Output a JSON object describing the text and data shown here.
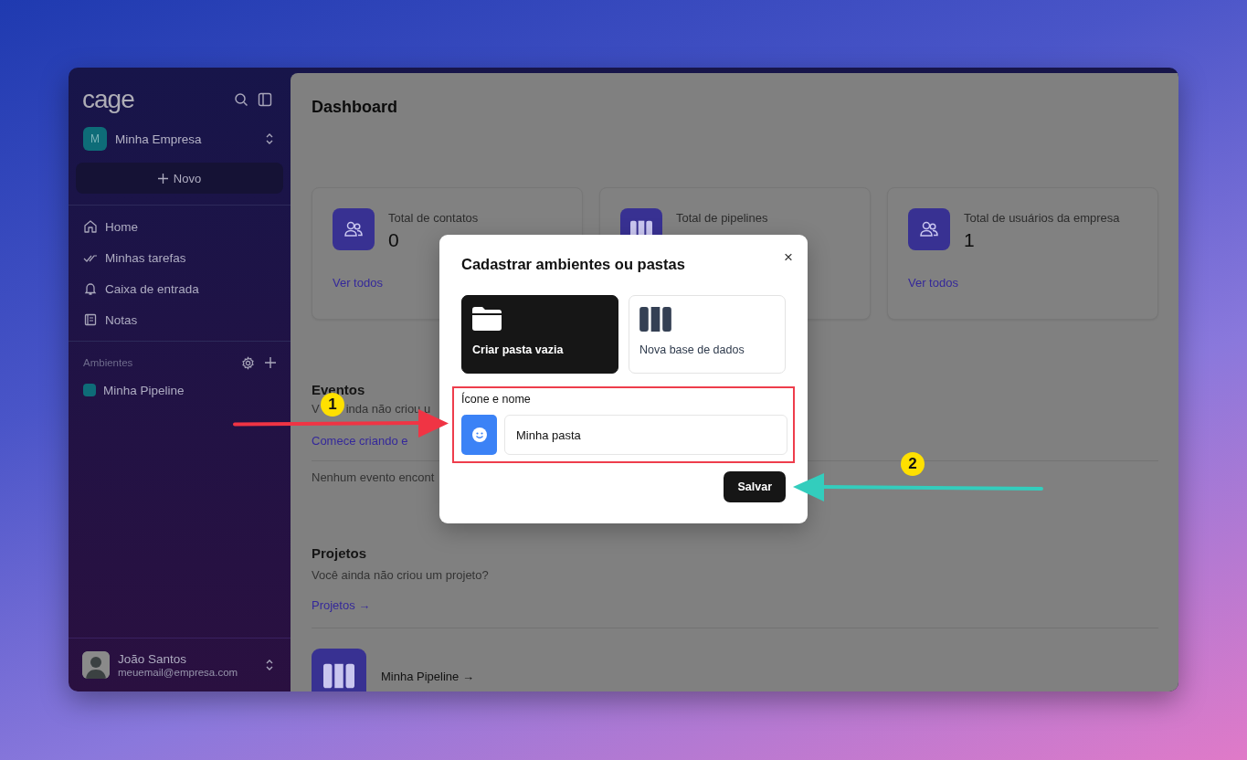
{
  "sidebar": {
    "logo": "cage",
    "workspace": {
      "initial": "M",
      "name": "Minha Empresa"
    },
    "new_button": "Novo",
    "nav_items": [
      {
        "label": "Home"
      },
      {
        "label": "Minhas tarefas"
      },
      {
        "label": "Caixa de entrada"
      },
      {
        "label": "Notas"
      }
    ],
    "section": {
      "title": "Ambientes",
      "items": [
        {
          "label": "Minha Pipeline",
          "color": "#0e6c78"
        }
      ]
    },
    "user": {
      "name": "João Santos",
      "email": "meuemail@empresa.com"
    }
  },
  "main": {
    "title": "Dashboard",
    "stats": [
      {
        "label": "Total de contatos",
        "value": "0",
        "link": "Ver todos"
      },
      {
        "label": "Total de pipelines"
      },
      {
        "label": "Total de usuários da empresa",
        "value": "1",
        "link": "Ver todos"
      }
    ],
    "events": {
      "title": "Eventos",
      "text_parts": [
        "V",
        "inda não criou u"
      ],
      "link": "Comece criando e",
      "empty": "Nenhum evento encont"
    },
    "projects": {
      "title": "Projetos",
      "text": "Você ainda não criou um projeto?",
      "link": "Projetos →",
      "items": [
        {
          "label": "Minha Pipeline →"
        }
      ]
    }
  },
  "modal": {
    "title": "Cadastrar ambientes ou pastas",
    "close": "×",
    "options": [
      {
        "label": "Criar pasta vazia",
        "selected": true
      },
      {
        "label": "Nova base de dados",
        "selected": false
      }
    ],
    "field_label": "Ícone e nome",
    "value": "Minha pasta",
    "save": "Salvar"
  },
  "annotations": [
    {
      "label": "1"
    },
    {
      "label": "2"
    }
  ]
}
